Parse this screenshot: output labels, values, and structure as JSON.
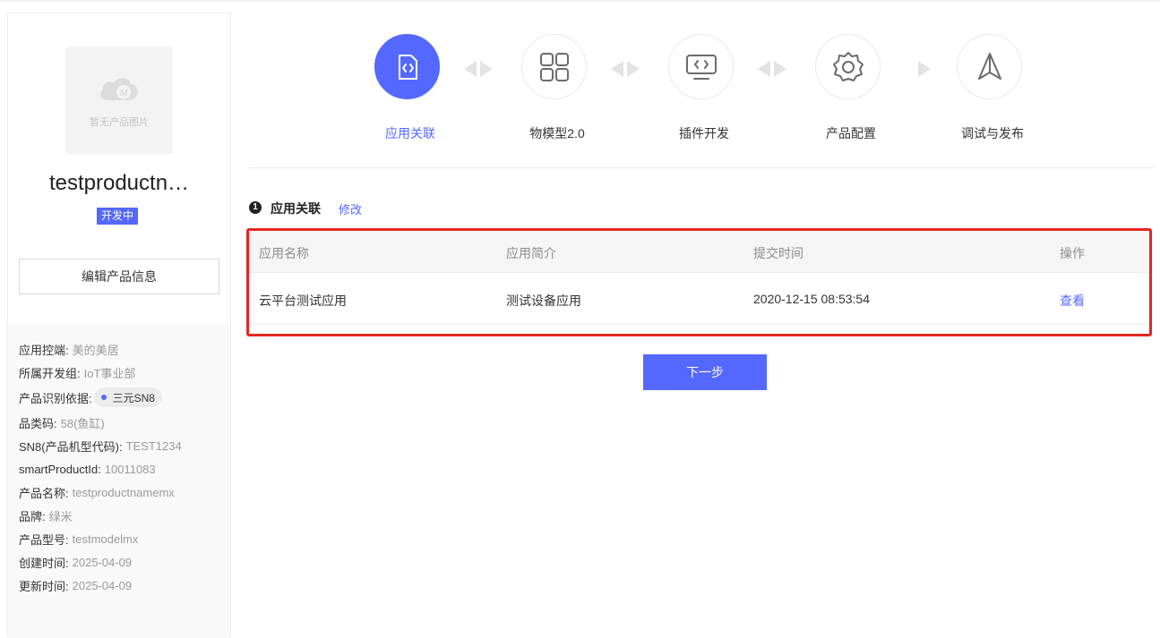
{
  "product": {
    "no_image_text": "暂无产品图片",
    "name": "testproductn…",
    "status": "开发中",
    "edit_label": "编辑产品信息"
  },
  "info": [
    {
      "key": "应用控端:",
      "value": "美的美居"
    },
    {
      "key": "所属开发组:",
      "value": "IoT事业部"
    },
    {
      "key": "产品识别依据:",
      "tag": "三元SN8"
    },
    {
      "key": "品类码:",
      "value": "58(鱼缸)"
    },
    {
      "key": "SN8(产品机型代码):",
      "value": "TEST1234"
    },
    {
      "key": "smartProductId:",
      "value": "10011083"
    },
    {
      "key": "产品名称:",
      "value": "testproductnamemx"
    },
    {
      "key": "品牌:",
      "value": "绿米"
    },
    {
      "key": "产品型号:",
      "value": "testmodelmx"
    },
    {
      "key": "创建时间:",
      "value": "2025-04-09"
    },
    {
      "key": "更新时间:",
      "value": "2025-04-09"
    }
  ],
  "steps": [
    {
      "label": "应用关联",
      "icon": "code-file-icon",
      "active": true
    },
    {
      "label": "物模型2.0",
      "icon": "grid-icon",
      "active": false
    },
    {
      "label": "插件开发",
      "icon": "monitor-code-icon",
      "active": false
    },
    {
      "label": "产品配置",
      "icon": "gear-icon",
      "active": false
    },
    {
      "label": "调试与发布",
      "icon": "paper-plane-icon",
      "active": false
    }
  ],
  "section": {
    "number": "1",
    "title": "应用关联",
    "edit_label": "修改"
  },
  "table": {
    "headers": [
      "应用名称",
      "应用简介",
      "提交时间",
      "操作"
    ],
    "rows": [
      [
        "云平台测试应用",
        "测试设备应用",
        "2020-12-15 08:53:54",
        "查看"
      ]
    ]
  },
  "next_label": "下一步",
  "colors": {
    "accent": "#5468ff",
    "highlight": "#e4261f"
  }
}
